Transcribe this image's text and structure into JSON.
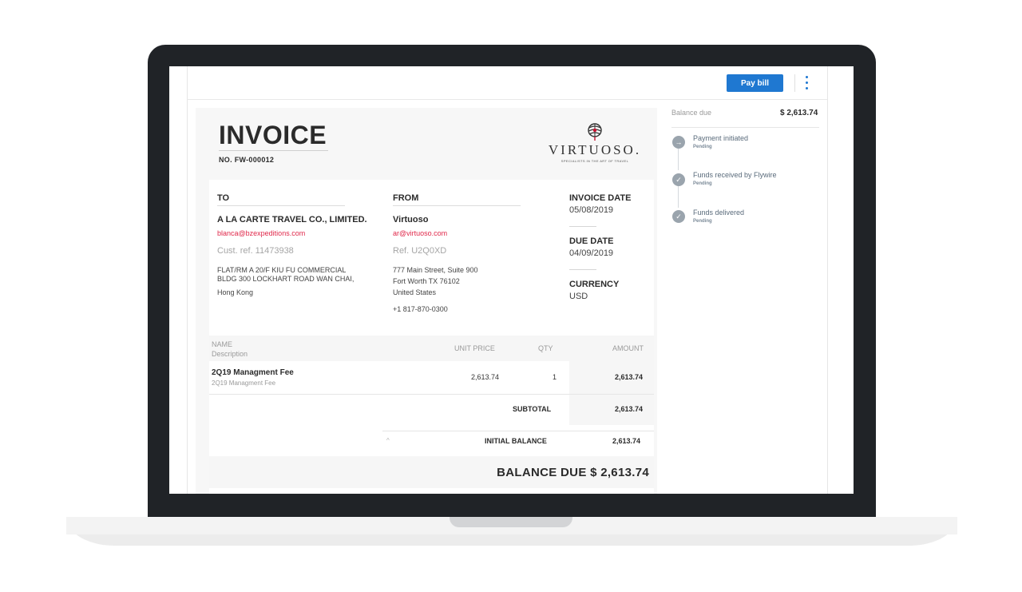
{
  "toolbar": {
    "pay_bill_label": "Pay bill"
  },
  "invoice": {
    "title": "INVOICE",
    "number": "NO. FW-000012",
    "logo": {
      "wordmark": "VIRTUOSO.",
      "tagline": "SPECIALISTS IN THE ART OF TRAVEL"
    },
    "to": {
      "heading": "TO",
      "name": "A LA CARTE TRAVEL CO., LIMITED.",
      "email": "blanca@bzexpeditions.com",
      "ref": "Cust. ref. 11473938",
      "address_line1": "FLAT/RM A 20/F KIU FU COMMERCIAL",
      "address_line2": "BLDG 300 LOCKHART ROAD WAN CHAI,",
      "address_line3": "Hong Kong"
    },
    "from": {
      "heading": "FROM",
      "name": "Virtuoso",
      "email": "ar@virtuoso.com",
      "ref": "Ref. U2Q0XD",
      "address_line1": "777 Main Street, Suite 900",
      "address_line2": "Fort Worth TX 76102",
      "address_line3": "United States",
      "phone": "+1 817-870-0300"
    },
    "meta": {
      "invoice_date_label": "INVOICE DATE",
      "invoice_date": "05/08/2019",
      "due_date_label": "DUE DATE",
      "due_date": "04/09/2019",
      "currency_label": "CURRENCY",
      "currency": "USD"
    },
    "table": {
      "columns": {
        "name": "NAME",
        "description": "Description",
        "unit_price": "UNIT PRICE",
        "qty": "QTY",
        "amount": "AMOUNT"
      },
      "rows": [
        {
          "name": "2Q19 Managment Fee",
          "description": "2Q19 Managment Fee",
          "unit_price": "2,613.74",
          "qty": "1",
          "amount": "2,613.74"
        }
      ],
      "subtotal_label": "SUBTOTAL",
      "subtotal": "2,613.74",
      "initial_balance_label": "INITIAL BALANCE",
      "initial_balance": "2,613.74",
      "balance_due": "BALANCE DUE  $ 2,613.74"
    }
  },
  "side_panel": {
    "balance_label": "Balance due",
    "balance_value": "$ 2,613.74",
    "steps": [
      {
        "title": "Payment initiated",
        "status": "Pending",
        "icon": "arrow-right-icon"
      },
      {
        "title": "Funds received by Flywire",
        "status": "Pending",
        "icon": "check-icon"
      },
      {
        "title": "Funds delivered",
        "status": "Pending",
        "icon": "check-icon"
      }
    ]
  },
  "colors": {
    "laptop_bezel": "#202327",
    "accent_blue": "#1f78d1",
    "email_red": "#e0284a",
    "step_grey": "#9aa4ad"
  }
}
